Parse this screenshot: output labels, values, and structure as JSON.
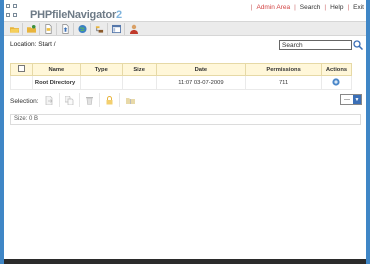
{
  "app": {
    "logo_text": "PHPfileNavigator",
    "version": "2"
  },
  "topnav": {
    "admin": "Admin Area",
    "search": "Search",
    "help": "Help",
    "exit": "Exit"
  },
  "toolbar": {
    "buttons": [
      {
        "icon": "open-folder-icon"
      },
      {
        "icon": "new-folder-icon"
      },
      {
        "icon": "new-file-icon"
      },
      {
        "icon": "upload-icon"
      },
      {
        "icon": "globe-icon"
      },
      {
        "icon": "tree-icon"
      },
      {
        "icon": "window-icon"
      },
      {
        "icon": "users-icon"
      }
    ]
  },
  "location": {
    "label": "Location:",
    "path": "Start /"
  },
  "search": {
    "value": "Search"
  },
  "table": {
    "headers": [
      "",
      "Name",
      "Type",
      "Size",
      "Date",
      "Permissions",
      "Actions"
    ],
    "rows": [
      {
        "name": "Root Directory",
        "type": "",
        "size": "",
        "date": "11:07 03-07-2009",
        "permissions": "711",
        "action_icon": "info-icon"
      }
    ]
  },
  "selection": {
    "label": "Selection:",
    "icons": [
      "move-icon",
      "copy-icon",
      "delete-icon",
      "lock-icon",
      "zip-icon"
    ],
    "view_select": "---"
  },
  "status": {
    "size": "Size: 0 B"
  },
  "colors": {
    "accent": "#3f86c6",
    "admin_link": "#d24343",
    "header_row": "#fff7d9"
  }
}
